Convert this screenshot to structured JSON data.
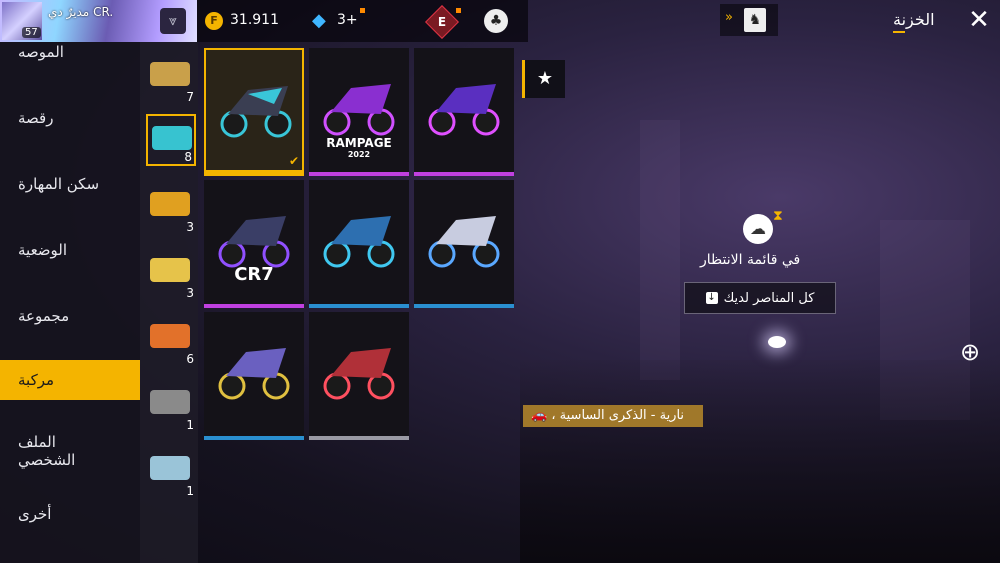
{
  "header": {
    "player_name": "مديرٌ دي CR.",
    "level": "57",
    "gold": "31.911",
    "diamonds": "3+",
    "rank_letter": "E"
  },
  "store": {
    "title": "الخزنة"
  },
  "categories": [
    {
      "label": "الموصه"
    },
    {
      "label": "رقصة"
    },
    {
      "label": "سكن المهارة"
    },
    {
      "label": "الوضعية"
    },
    {
      "label": "مجموعة"
    },
    {
      "label": "مركبة"
    },
    {
      "label": "الملف الشخصي"
    },
    {
      "label": "أخرى"
    }
  ],
  "vehicle_types": [
    {
      "count": "7",
      "color": "#c9a04a"
    },
    {
      "count": "8",
      "color": "#37c3d0"
    },
    {
      "count": "3",
      "color": "#e0a020"
    },
    {
      "count": "3",
      "color": "#e6c34a"
    },
    {
      "count": "6",
      "color": "#e2712a"
    },
    {
      "count": "1",
      "color": "#8a8a8a"
    },
    {
      "count": "1",
      "color": "#9ac4d8"
    }
  ],
  "items": [
    {
      "bar": "#f4b400",
      "body": "#3a3e52",
      "accent": "#39c6d8",
      "caption": ""
    },
    {
      "bar": "#c040e0",
      "body": "#8a2fd0",
      "accent": "#d050ff",
      "caption": "RAMPAGE",
      "sub": "2022"
    },
    {
      "bar": "#c040e0",
      "body": "#5a2fc0",
      "accent": "#e050ff",
      "caption": ""
    },
    {
      "bar": "#c040e0",
      "body": "#3a3e66",
      "accent": "#9050ff",
      "caption": "CR7"
    },
    {
      "bar": "#2a8fd0",
      "body": "#2d6fb0",
      "accent": "#40c8f0",
      "caption": ""
    },
    {
      "bar": "#2a8fd0",
      "body": "#c8cce0",
      "accent": "#5aa8ff",
      "caption": ""
    },
    {
      "bar": "#2a8fd0",
      "body": "#6a60c0",
      "accent": "#e0c040",
      "caption": ""
    },
    {
      "bar": "#9a9aa4",
      "body": "#b03038",
      "accent": "#ff5060",
      "caption": ""
    }
  ],
  "status": {
    "waiting": "في قائمة الانتظار",
    "all_items": "كل المناصر لديك"
  },
  "banner": {
    "text": "، نارية - الذكرى الساسية"
  }
}
